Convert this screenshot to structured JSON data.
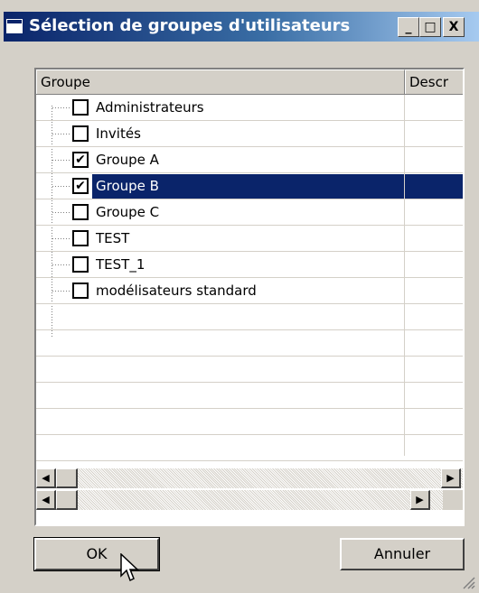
{
  "window": {
    "title": "Sélection de groupes d'utilisateurs",
    "controls": {
      "minimize": "_",
      "maximize": "□",
      "close": "X"
    }
  },
  "tree": {
    "columns": [
      "Groupe",
      "Descr"
    ],
    "items": [
      {
        "label": "Administrateurs",
        "checked": false,
        "selected": false
      },
      {
        "label": "Invités",
        "checked": false,
        "selected": false
      },
      {
        "label": "Groupe A",
        "checked": true,
        "selected": false
      },
      {
        "label": "Groupe B",
        "checked": true,
        "selected": true
      },
      {
        "label": "Groupe C",
        "checked": false,
        "selected": false
      },
      {
        "label": "TEST",
        "checked": false,
        "selected": false
      },
      {
        "label": "TEST_1",
        "checked": false,
        "selected": false
      },
      {
        "label": "modélisateurs standard",
        "checked": false,
        "selected": false
      }
    ]
  },
  "buttons": {
    "ok": "OK",
    "cancel": "Annuler"
  },
  "colors": {
    "selection": "#0a246a",
    "face": "#d4d0c8"
  }
}
